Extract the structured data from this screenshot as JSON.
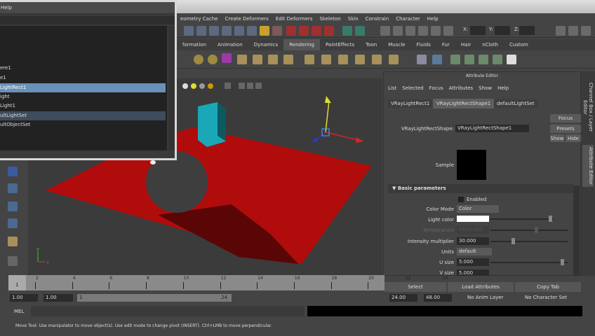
{
  "outliner": {
    "menu_help": "Help",
    "items": [
      "ere1",
      "e1",
      "LightRect1",
      "ight",
      "Light1",
      "ultLightSet",
      "ultObjectSet"
    ]
  },
  "menubar": [
    "eometry Cache",
    "Create Deformers",
    "Edit Deformers",
    "Skeleton",
    "Skin",
    "Constrain",
    "Character",
    "Help"
  ],
  "coords": {
    "x": "X:",
    "y": "Y:",
    "z": "Z:"
  },
  "shelf_tabs": [
    "formation",
    "Animation",
    "Dynamics",
    "Rendering",
    "PaintEffects",
    "Toon",
    "Muscle",
    "Fluids",
    "Fur",
    "Hair",
    "nCloth",
    "Custom"
  ],
  "viewport": {
    "axis_y": "y",
    "axis_x": "x"
  },
  "attribute_editor": {
    "title": "Attribute Editor",
    "menu": [
      "List",
      "Selected",
      "Focus",
      "Attributes",
      "Show",
      "Help"
    ],
    "tabs": [
      "VRayLightRect1",
      "VRayLightRectShape1",
      "defaultLightSet"
    ],
    "node_label": "VRayLightRectShape:",
    "node_value": "VRayLightRectShape1",
    "focus": "Focus",
    "presets": "Presets",
    "show": "Show",
    "hide": "Hide",
    "sample": "Sample",
    "section": "Basic parameters",
    "enabled": "Enabled",
    "color_mode_label": "Color Mode",
    "color_mode": "Color",
    "light_color_label": "Light color",
    "light_color": "#ffffff",
    "temperature_label": "Temperature",
    "temperature": "6500.000",
    "intensity_label": "Intensity multiplier",
    "intensity": "30.000",
    "units_label": "Units",
    "units": "default",
    "usize_label": "U size",
    "usize": "5.000",
    "vsize_label": "V size",
    "vsize": "5.000",
    "select": "Select",
    "load_attributes": "Load Attributes",
    "copy_tab": "Copy Tab"
  },
  "side_tabs": {
    "channel_box": "Channel Box / Layer Editor",
    "attribute_editor": "Attribute Editor"
  },
  "timeline": {
    "current": "1",
    "ticks": [
      "2",
      "4",
      "6",
      "8",
      "10",
      "12",
      "14",
      "16",
      "18",
      "20",
      "22",
      "24"
    ]
  },
  "range": {
    "start": "1.00",
    "start2": "1.00",
    "slider_start": "1",
    "slider_end": "24",
    "end": "24.00",
    "end2": "48.00",
    "anim_layer": "No Anim Layer",
    "char_set": "No Character Set"
  },
  "mel": {
    "label": "MEL"
  },
  "help_line": "Move Tool: Use manipulator to move object(s). Use edit mode to change pivot (INSERT). Ctrl+LMB to move perpendicular."
}
